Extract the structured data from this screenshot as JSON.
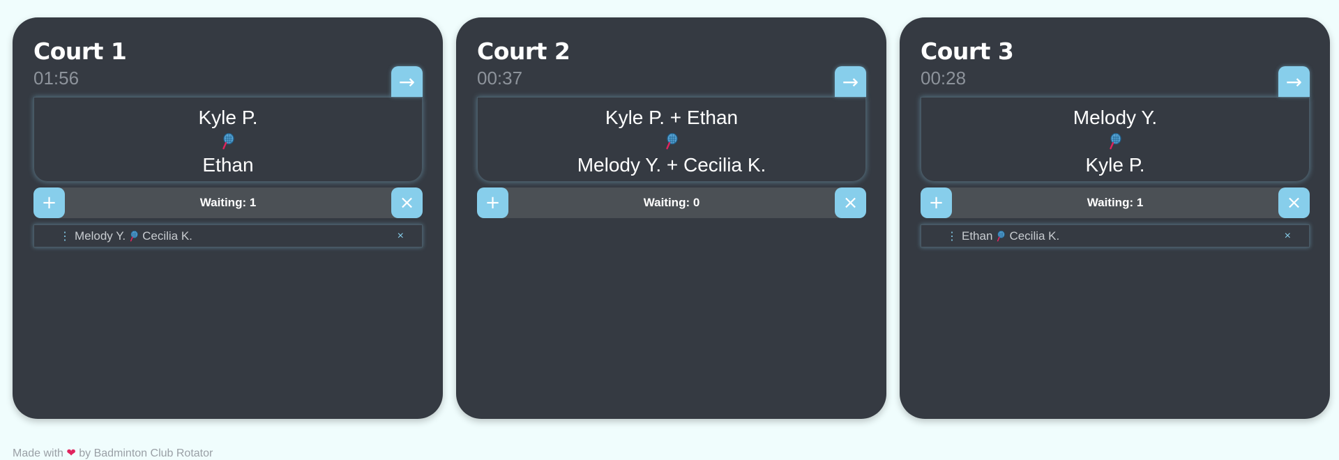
{
  "courts": [
    {
      "title": "Court 1",
      "timer": "01:56",
      "next_label": "→",
      "team_a": "Kyle P.",
      "team_b": "Ethan",
      "waiting_label": "Waiting: 1",
      "add_label": "+",
      "clear_label": "×",
      "queue": [
        {
          "a": "Melody Y.",
          "b": "Cecilia K.",
          "remove_label": "×"
        }
      ]
    },
    {
      "title": "Court 2",
      "timer": "00:37",
      "next_label": "→",
      "team_a": "Kyle P. + Ethan",
      "team_b": "Melody Y. + Cecilia K.",
      "waiting_label": "Waiting: 0",
      "add_label": "+",
      "clear_label": "×",
      "queue": []
    },
    {
      "title": "Court 3",
      "timer": "00:28",
      "next_label": "→",
      "team_a": "Melody Y.",
      "team_b": "Kyle P.",
      "waiting_label": "Waiting: 1",
      "add_label": "+",
      "clear_label": "×",
      "queue": [
        {
          "a": "Ethan",
          "b": "Cecilia K.",
          "remove_label": "×"
        }
      ]
    }
  ],
  "icons": {
    "next": "arrow-right-icon",
    "versus": "badminton-racket-icon",
    "add": "plus-icon",
    "clear": "close-icon",
    "drag": "drag-handle-icon"
  },
  "colors": {
    "accent": "#87ceeb",
    "card": "#353a42",
    "background": "#f0fdfd",
    "heart": "#e0245e"
  },
  "footer": {
    "prefix": "Made with",
    "suffix": "by Badminton Club Rotator"
  }
}
